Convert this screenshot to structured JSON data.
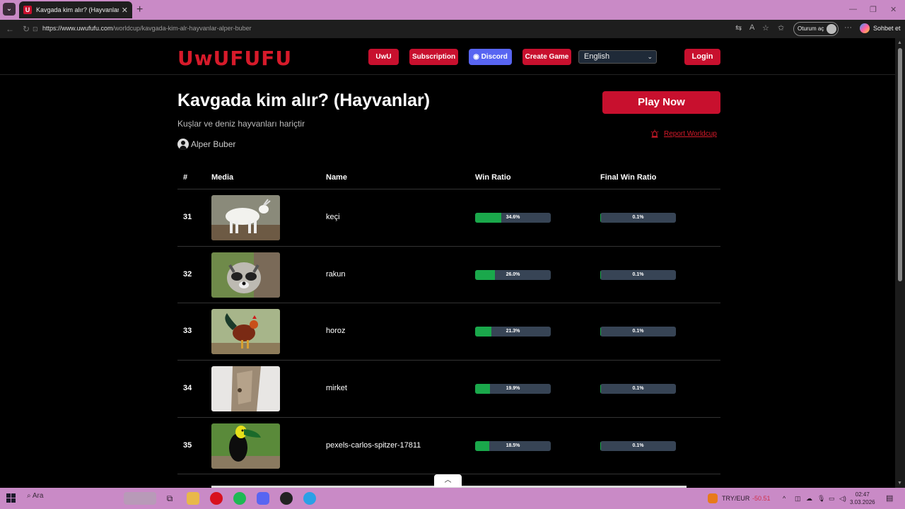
{
  "browser": {
    "tab_title": "Kavgada kim alır? (Hayvanlar) | Uw",
    "tab_favicon_letter": "U",
    "url_domain": "https://www.uwufufu.com",
    "url_path": "/worldcup/kavgada-kim-alr-hayvanlar-alper-buber",
    "signin_label": "Oturum aç",
    "copilot_label": "Sohbet et"
  },
  "header": {
    "logo": "UwUFUFU",
    "nav": {
      "uwu": "UwU",
      "subscription": "Subscription",
      "discord": "Discord",
      "create_game": "Create Game",
      "login": "Login"
    },
    "language_selected": "English"
  },
  "worldcup": {
    "title": "Kavgada kim alır? (Hayvanlar)",
    "subtitle": "Kuşlar ve deniz hayvanları hariçtir",
    "author": "Alper Buber",
    "play_label": "Play Now",
    "report_label": "Report Worldcup"
  },
  "table": {
    "headers": {
      "rank": "#",
      "media": "Media",
      "name": "Name",
      "win_ratio": "Win Ratio",
      "final_win_ratio": "Final Win Ratio"
    },
    "rows": [
      {
        "rank": "31",
        "name": "keçi",
        "win": "34.6%",
        "win_value": 34.6,
        "final": "0.1%",
        "final_value": 0.1
      },
      {
        "rank": "32",
        "name": "rakun",
        "win": "26.0%",
        "win_value": 26.0,
        "final": "0.1%",
        "final_value": 0.1
      },
      {
        "rank": "33",
        "name": "horoz",
        "win": "21.3%",
        "win_value": 21.3,
        "final": "0.1%",
        "final_value": 0.1
      },
      {
        "rank": "34",
        "name": "mirket",
        "win": "19.9%",
        "win_value": 19.9,
        "final": "0.1%",
        "final_value": 0.1
      },
      {
        "rank": "35",
        "name": "pexels-carlos-spitzer-17811",
        "win": "18.5%",
        "win_value": 18.5,
        "final": "0.1%",
        "final_value": 0.1
      }
    ]
  },
  "taskbar": {
    "search_label": "Ara",
    "currency_label": "TRY/EUR",
    "currency_change": "-50.51",
    "time": "02:47",
    "date": "3.03.2026"
  },
  "colors": {
    "brand_red": "#c8102e",
    "discord": "#5865f2",
    "bar_fill": "#1aa84b",
    "bar_track": "#374455"
  }
}
